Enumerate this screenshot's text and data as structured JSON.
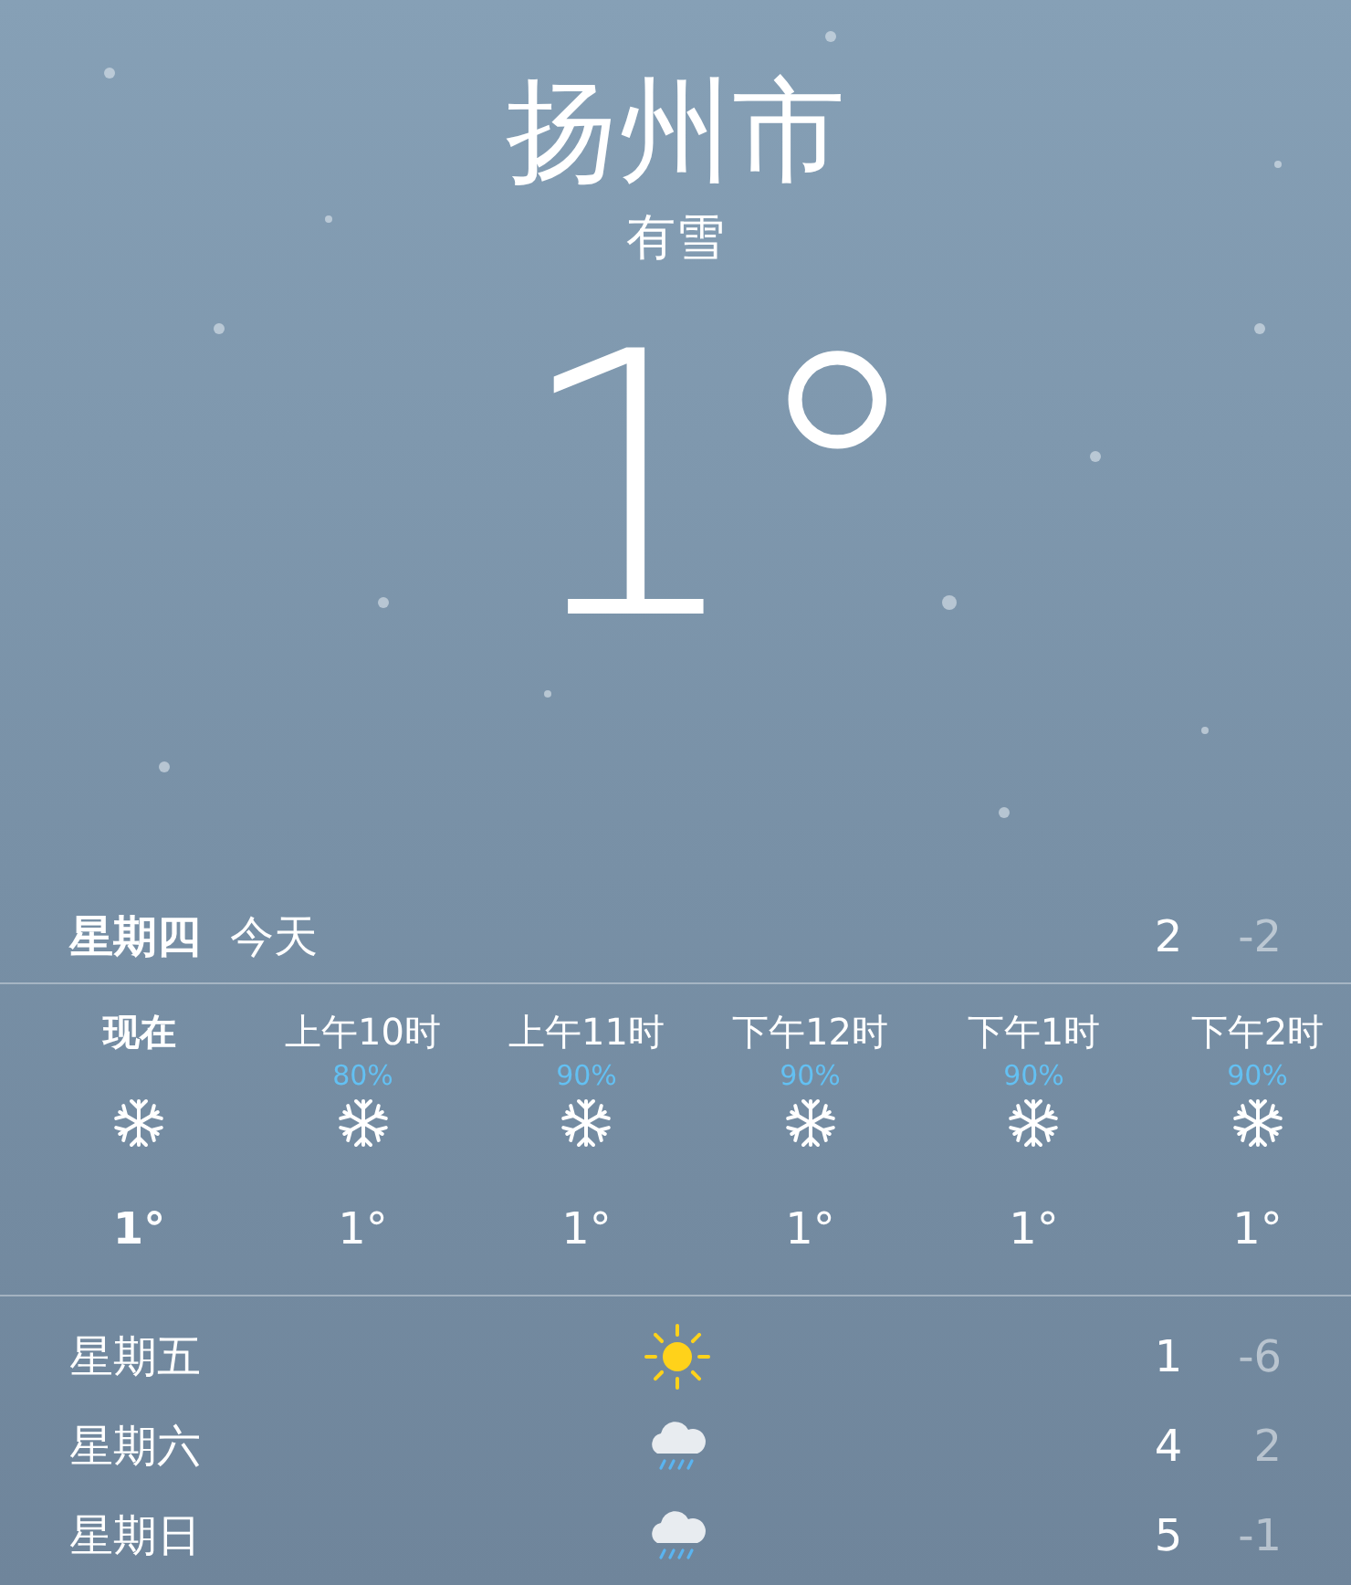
{
  "location": {
    "city": "扬州市",
    "condition": "有雪",
    "temperature": "1°"
  },
  "today": {
    "day": "星期四",
    "label": "今天",
    "high": "2",
    "low": "-2"
  },
  "hourly": [
    {
      "time": "现在",
      "kind": "snow",
      "temp": "1°",
      "now": true
    },
    {
      "time": "上午10时",
      "chance": "80%",
      "kind": "snow",
      "temp": "1°",
      "now": false
    },
    {
      "time": "上午11时",
      "chance": "90%",
      "kind": "snow",
      "temp": "1°",
      "now": false
    },
    {
      "time": "下午12时",
      "chance": "90%",
      "kind": "snow",
      "temp": "1°",
      "now": false
    },
    {
      "time": "下午1时",
      "chance": "90%",
      "kind": "snow",
      "temp": "1°",
      "now": false
    },
    {
      "time": "下午2时",
      "chance": "90%",
      "kind": "snow",
      "temp": "1°",
      "now": false
    }
  ],
  "daily": [
    {
      "day": "星期五",
      "kind": "sun",
      "high": "1",
      "low": "-6"
    },
    {
      "day": "星期六",
      "kind": "rain",
      "high": "4",
      "low": "2"
    },
    {
      "day": "星期日",
      "kind": "rain",
      "high": "5",
      "low": "-1"
    }
  ]
}
